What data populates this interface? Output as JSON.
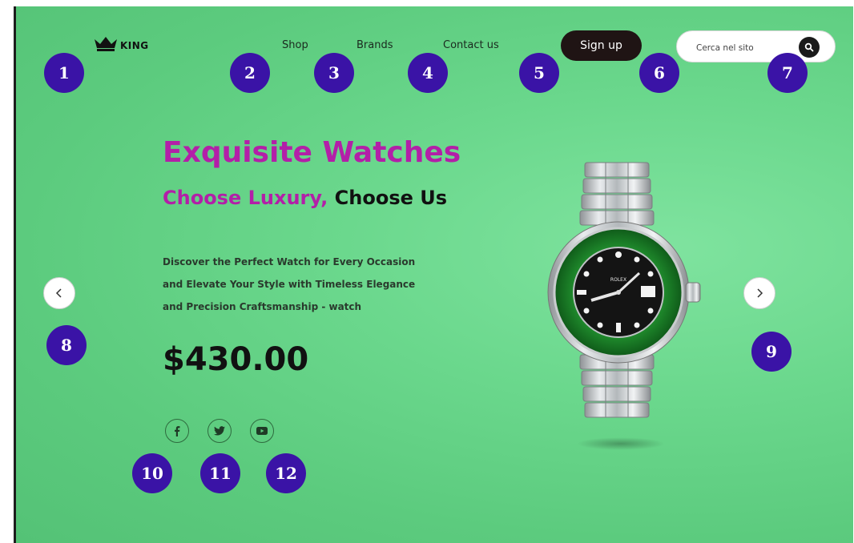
{
  "header": {
    "logo_text": "KING",
    "nav": [
      {
        "label": "Shop"
      },
      {
        "label": "Brands"
      },
      {
        "label": "Contact us"
      }
    ],
    "signup_label": "Sign up",
    "search": {
      "placeholder": "Cerca nel sito",
      "value": ""
    }
  },
  "hero": {
    "title": "Exquisite Watches",
    "subtitle_accent": "Choose Luxury,",
    "subtitle_plain": "Choose Us",
    "description": [
      "Discover the Perfect Watch for Every Occasion",
      "and Elevate Your Style with Timeless Elegance",
      "and Precision Craftsmanship - watch"
    ],
    "price": "$430.00"
  },
  "social": [
    {
      "icon": "facebook-icon"
    },
    {
      "icon": "twitter-icon"
    },
    {
      "icon": "youtube-icon"
    }
  ],
  "product_image": {
    "brand_text": "ROLEX",
    "icon": "watch-image"
  },
  "carousel": {
    "prev_icon": "chevron-left-icon",
    "next_icon": "chevron-right-icon"
  },
  "badges": [
    "1",
    "2",
    "3",
    "4",
    "5",
    "6",
    "7",
    "8",
    "9",
    "10",
    "11",
    "12"
  ],
  "colors": {
    "background": "#5ccb7e",
    "accent": "#b31fa8",
    "badge": "#3a13a6",
    "signup": "#1f1414"
  }
}
